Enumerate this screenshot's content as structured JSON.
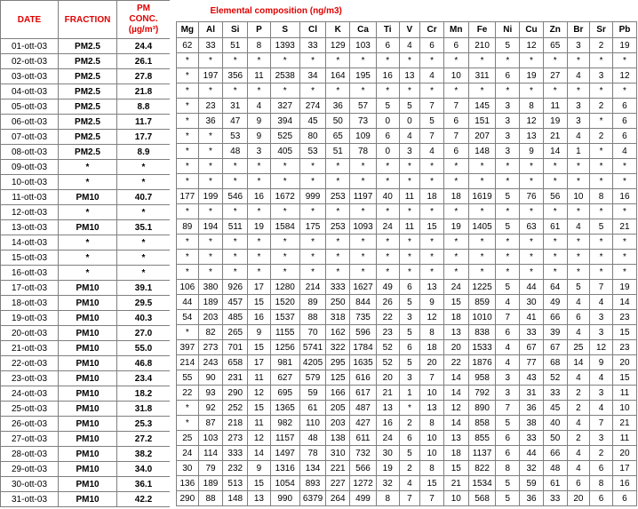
{
  "header": {
    "date": "DATE",
    "fraction": "FRACTION",
    "pm_line1": "PM",
    "pm_line2": "CONC.",
    "pm_line3": "(µg/m³)",
    "elemental": "Elemental composition (ng/m3)"
  },
  "elements": [
    "Mg",
    "Al",
    "Si",
    "P",
    "S",
    "Cl",
    "K",
    "Ca",
    "Ti",
    "V",
    "Cr",
    "Mn",
    "Fe",
    "Ni",
    "Cu",
    "Zn",
    "Br",
    "Sr",
    "Pb"
  ],
  "rows": [
    {
      "date": "01-ott-03",
      "fraction": "PM2.5",
      "pm": "24.4",
      "v": [
        "62",
        "33",
        "51",
        "8",
        "1393",
        "33",
        "129",
        "103",
        "6",
        "4",
        "6",
        "6",
        "210",
        "5",
        "12",
        "65",
        "3",
        "2",
        "19"
      ]
    },
    {
      "date": "02-ott-03",
      "fraction": "PM2.5",
      "pm": "26.1",
      "v": [
        "*",
        "*",
        "*",
        "*",
        "*",
        "*",
        "*",
        "*",
        "*",
        "*",
        "*",
        "*",
        "*",
        "*",
        "*",
        "*",
        "*",
        "*",
        "*"
      ]
    },
    {
      "date": "03-ott-03",
      "fraction": "PM2.5",
      "pm": "27.8",
      "v": [
        "*",
        "197",
        "356",
        "11",
        "2538",
        "34",
        "164",
        "195",
        "16",
        "13",
        "4",
        "10",
        "311",
        "6",
        "19",
        "27",
        "4",
        "3",
        "12"
      ]
    },
    {
      "date": "04-ott-03",
      "fraction": "PM2.5",
      "pm": "21.8",
      "v": [
        "*",
        "*",
        "*",
        "*",
        "*",
        "*",
        "*",
        "*",
        "*",
        "*",
        "*",
        "*",
        "*",
        "*",
        "*",
        "*",
        "*",
        "*",
        "*"
      ]
    },
    {
      "date": "05-ott-03",
      "fraction": "PM2.5",
      "pm": "8.8",
      "v": [
        "*",
        "23",
        "31",
        "4",
        "327",
        "274",
        "36",
        "57",
        "5",
        "5",
        "7",
        "7",
        "145",
        "3",
        "8",
        "11",
        "3",
        "2",
        "6"
      ]
    },
    {
      "date": "06-ott-03",
      "fraction": "PM2.5",
      "pm": "11.7",
      "v": [
        "*",
        "36",
        "47",
        "9",
        "394",
        "45",
        "50",
        "73",
        "0",
        "0",
        "5",
        "6",
        "151",
        "3",
        "12",
        "19",
        "3",
        "*",
        "6"
      ]
    },
    {
      "date": "07-ott-03",
      "fraction": "PM2.5",
      "pm": "17.7",
      "v": [
        "*",
        "*",
        "53",
        "9",
        "525",
        "80",
        "65",
        "109",
        "6",
        "4",
        "7",
        "7",
        "207",
        "3",
        "13",
        "21",
        "4",
        "2",
        "6"
      ]
    },
    {
      "date": "08-ott-03",
      "fraction": "PM2.5",
      "pm": "8.9",
      "v": [
        "*",
        "*",
        "48",
        "3",
        "405",
        "53",
        "51",
        "78",
        "0",
        "3",
        "4",
        "6",
        "148",
        "3",
        "9",
        "14",
        "1",
        "*",
        "4"
      ]
    },
    {
      "date": "09-ott-03",
      "fraction": "*",
      "pm": "*",
      "v": [
        "*",
        "*",
        "*",
        "*",
        "*",
        "*",
        "*",
        "*",
        "*",
        "*",
        "*",
        "*",
        "*",
        "*",
        "*",
        "*",
        "*",
        "*",
        "*"
      ]
    },
    {
      "date": "10-ott-03",
      "fraction": "*",
      "pm": "*",
      "v": [
        "*",
        "*",
        "*",
        "*",
        "*",
        "*",
        "*",
        "*",
        "*",
        "*",
        "*",
        "*",
        "*",
        "*",
        "*",
        "*",
        "*",
        "*",
        "*"
      ]
    },
    {
      "date": "11-ott-03",
      "fraction": "PM10",
      "pm": "40.7",
      "v": [
        "177",
        "199",
        "546",
        "16",
        "1672",
        "999",
        "253",
        "1197",
        "40",
        "11",
        "18",
        "18",
        "1619",
        "5",
        "76",
        "56",
        "10",
        "8",
        "16"
      ]
    },
    {
      "date": "12-ott-03",
      "fraction": "*",
      "pm": "*",
      "v": [
        "*",
        "*",
        "*",
        "*",
        "*",
        "*",
        "*",
        "*",
        "*",
        "*",
        "*",
        "*",
        "*",
        "*",
        "*",
        "*",
        "*",
        "*",
        "*"
      ]
    },
    {
      "date": "13-ott-03",
      "fraction": "PM10",
      "pm": "35.1",
      "v": [
        "89",
        "194",
        "511",
        "19",
        "1584",
        "175",
        "253",
        "1093",
        "24",
        "11",
        "15",
        "19",
        "1405",
        "5",
        "63",
        "61",
        "4",
        "5",
        "21"
      ]
    },
    {
      "date": "14-ott-03",
      "fraction": "*",
      "pm": "*",
      "v": [
        "*",
        "*",
        "*",
        "*",
        "*",
        "*",
        "*",
        "*",
        "*",
        "*",
        "*",
        "*",
        "*",
        "*",
        "*",
        "*",
        "*",
        "*",
        "*"
      ]
    },
    {
      "date": "15-ott-03",
      "fraction": "*",
      "pm": "*",
      "v": [
        "*",
        "*",
        "*",
        "*",
        "*",
        "*",
        "*",
        "*",
        "*",
        "*",
        "*",
        "*",
        "*",
        "*",
        "*",
        "*",
        "*",
        "*",
        "*"
      ]
    },
    {
      "date": "16-ott-03",
      "fraction": "*",
      "pm": "*",
      "v": [
        "*",
        "*",
        "*",
        "*",
        "*",
        "*",
        "*",
        "*",
        "*",
        "*",
        "*",
        "*",
        "*",
        "*",
        "*",
        "*",
        "*",
        "*",
        "*"
      ]
    },
    {
      "date": "17-ott-03",
      "fraction": "PM10",
      "pm": "39.1",
      "v": [
        "106",
        "380",
        "926",
        "17",
        "1280",
        "214",
        "333",
        "1627",
        "49",
        "6",
        "13",
        "24",
        "1225",
        "5",
        "44",
        "64",
        "5",
        "7",
        "19"
      ]
    },
    {
      "date": "18-ott-03",
      "fraction": "PM10",
      "pm": "29.5",
      "v": [
        "44",
        "189",
        "457",
        "15",
        "1520",
        "89",
        "250",
        "844",
        "26",
        "5",
        "9",
        "15",
        "859",
        "4",
        "30",
        "49",
        "4",
        "4",
        "14"
      ]
    },
    {
      "date": "19-ott-03",
      "fraction": "PM10",
      "pm": "40.3",
      "v": [
        "54",
        "203",
        "485",
        "16",
        "1537",
        "88",
        "318",
        "735",
        "22",
        "3",
        "12",
        "18",
        "1010",
        "7",
        "41",
        "66",
        "6",
        "3",
        "23"
      ]
    },
    {
      "date": "20-ott-03",
      "fraction": "PM10",
      "pm": "27.0",
      "v": [
        "*",
        "82",
        "265",
        "9",
        "1155",
        "70",
        "162",
        "596",
        "23",
        "5",
        "8",
        "13",
        "838",
        "6",
        "33",
        "39",
        "4",
        "3",
        "15"
      ]
    },
    {
      "date": "21-ott-03",
      "fraction": "PM10",
      "pm": "55.0",
      "v": [
        "397",
        "273",
        "701",
        "15",
        "1256",
        "5741",
        "322",
        "1784",
        "52",
        "6",
        "18",
        "20",
        "1533",
        "4",
        "67",
        "67",
        "25",
        "12",
        "23"
      ]
    },
    {
      "date": "22-ott-03",
      "fraction": "PM10",
      "pm": "46.8",
      "v": [
        "214",
        "243",
        "658",
        "17",
        "981",
        "4205",
        "295",
        "1635",
        "52",
        "5",
        "20",
        "22",
        "1876",
        "4",
        "77",
        "68",
        "14",
        "9",
        "20"
      ]
    },
    {
      "date": "23-ott-03",
      "fraction": "PM10",
      "pm": "23.4",
      "v": [
        "55",
        "90",
        "231",
        "11",
        "627",
        "579",
        "125",
        "616",
        "20",
        "3",
        "7",
        "14",
        "958",
        "3",
        "43",
        "52",
        "4",
        "4",
        "15"
      ]
    },
    {
      "date": "24-ott-03",
      "fraction": "PM10",
      "pm": "18.2",
      "v": [
        "22",
        "93",
        "290",
        "12",
        "695",
        "59",
        "166",
        "617",
        "21",
        "1",
        "10",
        "14",
        "792",
        "3",
        "31",
        "33",
        "2",
        "3",
        "11"
      ]
    },
    {
      "date": "25-ott-03",
      "fraction": "PM10",
      "pm": "31.8",
      "v": [
        "*",
        "92",
        "252",
        "15",
        "1365",
        "61",
        "205",
        "487",
        "13",
        "*",
        "13",
        "12",
        "890",
        "7",
        "36",
        "45",
        "2",
        "4",
        "10"
      ]
    },
    {
      "date": "26-ott-03",
      "fraction": "PM10",
      "pm": "25.3",
      "v": [
        "*",
        "87",
        "218",
        "11",
        "982",
        "110",
        "203",
        "427",
        "16",
        "2",
        "8",
        "14",
        "858",
        "5",
        "38",
        "40",
        "4",
        "7",
        "21"
      ]
    },
    {
      "date": "27-ott-03",
      "fraction": "PM10",
      "pm": "27.2",
      "v": [
        "25",
        "103",
        "273",
        "12",
        "1157",
        "48",
        "138",
        "611",
        "24",
        "6",
        "10",
        "13",
        "855",
        "6",
        "33",
        "50",
        "2",
        "3",
        "11"
      ]
    },
    {
      "date": "28-ott-03",
      "fraction": "PM10",
      "pm": "38.2",
      "v": [
        "24",
        "114",
        "333",
        "14",
        "1497",
        "78",
        "310",
        "732",
        "30",
        "5",
        "10",
        "18",
        "1137",
        "6",
        "44",
        "66",
        "4",
        "2",
        "20"
      ]
    },
    {
      "date": "29-ott-03",
      "fraction": "PM10",
      "pm": "34.0",
      "v": [
        "30",
        "79",
        "232",
        "9",
        "1316",
        "134",
        "221",
        "566",
        "19",
        "2",
        "8",
        "15",
        "822",
        "8",
        "32",
        "48",
        "4",
        "6",
        "17"
      ]
    },
    {
      "date": "30-ott-03",
      "fraction": "PM10",
      "pm": "36.1",
      "v": [
        "136",
        "189",
        "513",
        "15",
        "1054",
        "893",
        "227",
        "1272",
        "32",
        "4",
        "15",
        "21",
        "1534",
        "5",
        "59",
        "61",
        "6",
        "8",
        "16"
      ]
    },
    {
      "date": "31-ott-03",
      "fraction": "PM10",
      "pm": "42.2",
      "v": [
        "290",
        "88",
        "148",
        "13",
        "990",
        "6379",
        "264",
        "499",
        "8",
        "7",
        "7",
        "10",
        "568",
        "5",
        "36",
        "33",
        "20",
        "6",
        "6"
      ]
    }
  ]
}
